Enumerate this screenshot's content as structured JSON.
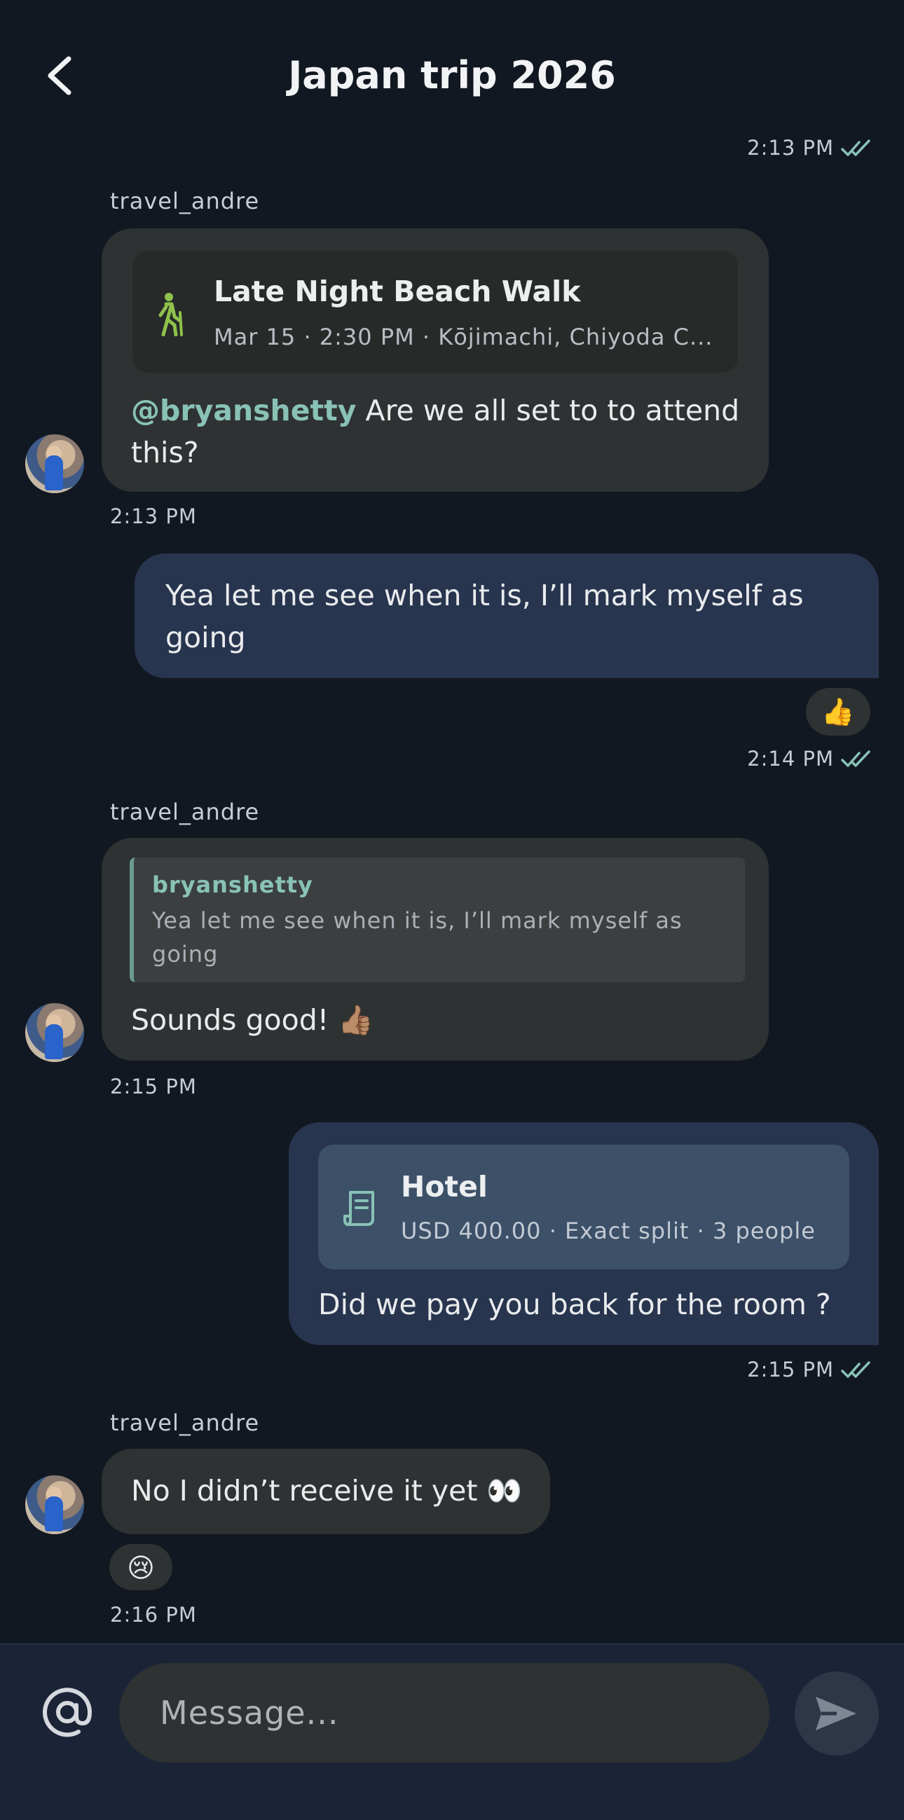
{
  "header": {
    "title": "Japan trip 2026"
  },
  "messages": [
    {
      "time": "2:13 PM"
    },
    {
      "sender": "travel_andre",
      "event_card": {
        "title": "Late Night Beach Walk",
        "details": "Mar 15 · 2:30 PM · Kōjimachi, Chiyoda C..."
      },
      "mention": "@bryanshetty",
      "text": " Are we all set to to attend this?",
      "time": "2:13 PM"
    },
    {
      "text": "Yea let me see when it is, I’ll mark myself as going",
      "reaction": "👍",
      "time": "2:14 PM"
    },
    {
      "sender": "travel_andre",
      "reply_to": {
        "name": "bryanshetty",
        "text": "Yea let me see when it is, I’ll mark myself as going"
      },
      "text": "Sounds good! 👍🏽",
      "time": "2:15 PM"
    },
    {
      "expense_card": {
        "title": "Hotel",
        "details": "USD 400.00 · Exact split · 3 people"
      },
      "text": "Did we pay you back for the room ?",
      "time": "2:15 PM"
    },
    {
      "sender": "travel_andre",
      "text": "No I didn’t receive it yet 👀",
      "reaction": "😢",
      "time": "2:16 PM"
    }
  ],
  "composer": {
    "placeholder": "Message..."
  },
  "colors": {
    "background": "#121821",
    "incoming_bubble": "#2f3232",
    "outgoing_bubble": "#28354f",
    "accent": "#89c2b6",
    "hike_icon": "#8fc24a"
  },
  "icons": [
    "back-chevron-icon",
    "double-check-icon",
    "hiking-icon",
    "receipt-icon",
    "at-sign-icon",
    "send-icon"
  ]
}
